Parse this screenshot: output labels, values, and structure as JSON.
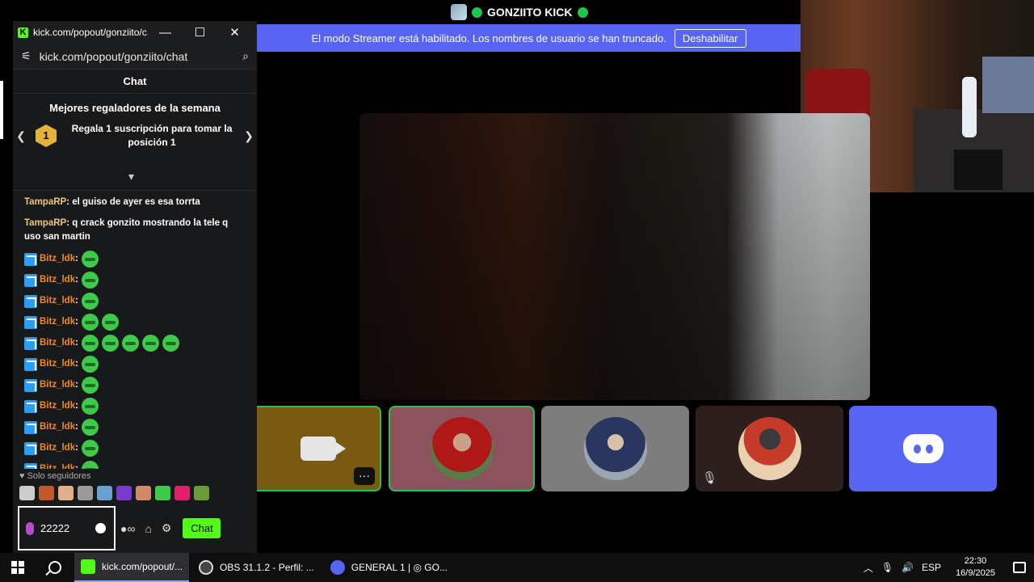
{
  "discord": {
    "channel_title": "GONZIITO KICK",
    "streamer_notice": "El modo Streamer está habilitado. Los nombres de usuario se han truncado.",
    "disable_label": "Deshabilitar",
    "more_label": "···"
  },
  "kick_window": {
    "title": "kick.com/popout/gonziito/c...",
    "url": "kick.com/popout/gonziito/chat",
    "chat_header": "Chat",
    "top_gifters_title": "Mejores regaladores de la semana",
    "rank_badge": "1",
    "gift_prompt": "Regala 1 suscripción para tomar la posición 1",
    "messages": [
      {
        "user": "TampaRP",
        "text": ": el guiso de ayer es esa torrta"
      },
      {
        "user": "TampaRP",
        "text": ": q crack gonzito mostrando la tele q uso san martin"
      }
    ],
    "repeat_messages": [
      {
        "user": "Bitz_ldk",
        "emotes": 1
      },
      {
        "user": "Bitz_ldk",
        "emotes": 1
      },
      {
        "user": "Bitz_ldk",
        "emotes": 1
      },
      {
        "user": "Bitz_ldk",
        "emotes": 2
      },
      {
        "user": "Bitz_ldk",
        "emotes": 5
      },
      {
        "user": "Bitz_ldk",
        "emotes": 1
      },
      {
        "user": "Bitz_ldk",
        "emotes": 1
      },
      {
        "user": "Bitz_ldk",
        "emotes": 1
      },
      {
        "user": "Bitz_ldk",
        "emotes": 1
      },
      {
        "user": "Bitz_ldk",
        "emotes": 1
      },
      {
        "user": "Bitz_ldk",
        "emotes": 1
      }
    ],
    "followers_only": "Solo seguidores",
    "input_value": "22222",
    "send_label": "Chat"
  },
  "taskbar": {
    "apps": [
      {
        "label": "kick.com/popout/...",
        "active": true,
        "color": "#53fc18"
      },
      {
        "label": "OBS 31.1.2 - Perfil: ...",
        "active": false,
        "color": "#444444"
      },
      {
        "label": "GENERAL 1 | ◎ GO...",
        "active": false,
        "color": "#5865f2"
      }
    ],
    "language": "ESP",
    "time": "22:30",
    "date": "16/9/2025"
  },
  "colors": {
    "discord_blurple": "#5865f2",
    "kick_green": "#53fc18",
    "speaking_green": "#23c552"
  }
}
